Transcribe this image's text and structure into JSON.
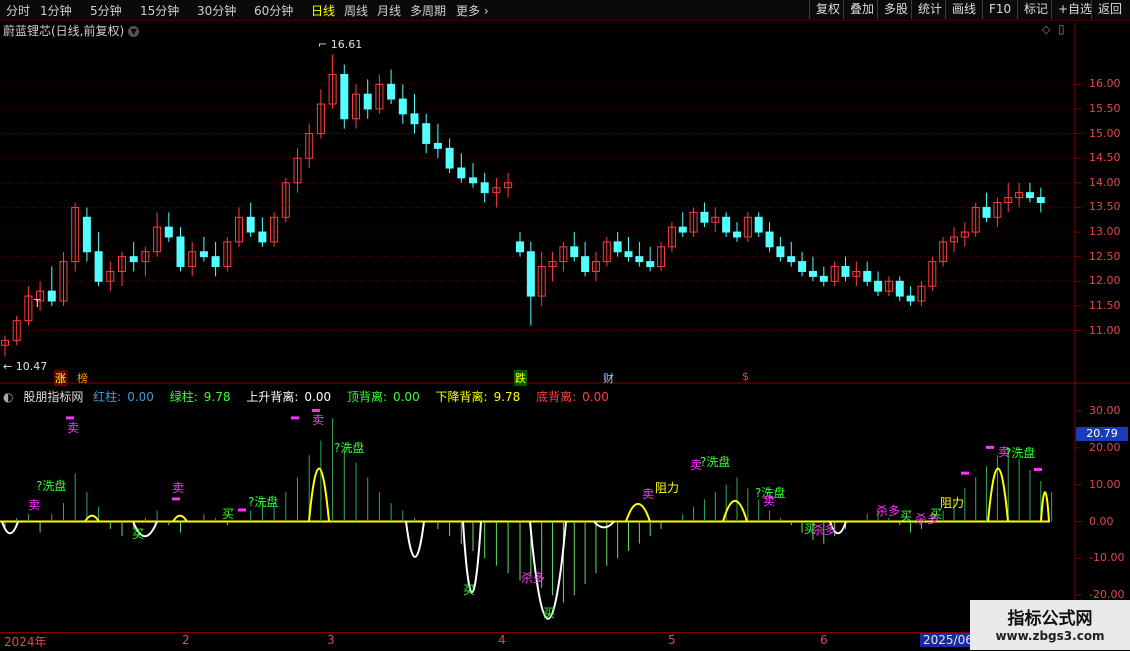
{
  "toolbar": {
    "periods": [
      "分时",
      "1分钟",
      "5分钟",
      "15分钟",
      "30分钟",
      "60分钟",
      "日线",
      "周线",
      "月线",
      "多周期",
      "更多"
    ],
    "active_period": "日线",
    "tools": [
      "复权",
      "叠加",
      "多股",
      "统计",
      "画线",
      "F10",
      "标记",
      "+自选",
      "返回"
    ]
  },
  "stock": {
    "title": "蔚蓝锂芯(日线,前复权)"
  },
  "price_axis": [
    "16.00",
    "15.50",
    "15.00",
    "14.50",
    "14.00",
    "13.50",
    "13.00",
    "12.50",
    "12.00",
    "11.50",
    "11.00"
  ],
  "price_labels": {
    "high": "16.61",
    "low": "10.47"
  },
  "event_marks": [
    "涨",
    "榜",
    "跌",
    "财",
    "$"
  ],
  "indicator": {
    "name": "股朋指标网",
    "red_label": "红柱:",
    "red_value": "0.00",
    "green_label": "绿柱:",
    "green_value": "9.78",
    "up_div_label": "上升背离:",
    "up_div_value": "0.00",
    "top_div_label": "顶背离:",
    "top_div_value": "0.00",
    "down_div_label": "下降背离:",
    "down_div_value": "9.78",
    "bottom_div_label": "底背离:",
    "bottom_div_value": "0.00",
    "current": "20.79"
  },
  "ind_axis": [
    "30.00",
    "20.00",
    "10.00",
    "0.00",
    "-10.00",
    "-20.00"
  ],
  "ind_signals": {
    "buy": "买",
    "sell": "卖",
    "wash": "?洗盘",
    "kill": "杀多",
    "resist": "阻力"
  },
  "dates": [
    "2024年",
    "2",
    "3",
    "4",
    "5",
    "6",
    "2025/06/"
  ],
  "watermark": {
    "title": "指标公式网",
    "url": "www.zbgs3.com"
  },
  "colors": {
    "up": "#ff3c3c",
    "down": "#54ffff",
    "signal_yellow": "#ffff00",
    "signal_magenta": "#ff33ff",
    "buy_green": "#33ff33"
  },
  "chart_data": {
    "type": "candlestick",
    "ohlc": [
      [
        10.7,
        10.9,
        10.47,
        10.8
      ],
      [
        10.8,
        11.3,
        10.7,
        11.2
      ],
      [
        11.2,
        11.9,
        11.1,
        11.7
      ],
      [
        11.6,
        12.0,
        11.4,
        11.8
      ],
      [
        11.8,
        12.3,
        11.5,
        11.6
      ],
      [
        11.6,
        12.6,
        11.5,
        12.4
      ],
      [
        12.4,
        13.6,
        12.2,
        13.5
      ],
      [
        13.3,
        13.5,
        12.4,
        12.6
      ],
      [
        12.6,
        13.0,
        11.9,
        12.0
      ],
      [
        12.0,
        12.4,
        11.8,
        12.2
      ],
      [
        12.2,
        12.6,
        11.9,
        12.5
      ],
      [
        12.5,
        12.8,
        12.2,
        12.4
      ],
      [
        12.4,
        12.7,
        12.1,
        12.6
      ],
      [
        12.6,
        13.4,
        12.5,
        13.1
      ],
      [
        13.1,
        13.4,
        12.8,
        12.9
      ],
      [
        12.9,
        13.1,
        12.2,
        12.3
      ],
      [
        12.3,
        12.8,
        12.1,
        12.6
      ],
      [
        12.6,
        12.9,
        12.4,
        12.5
      ],
      [
        12.5,
        12.8,
        12.1,
        12.3
      ],
      [
        12.3,
        12.9,
        12.2,
        12.8
      ],
      [
        12.8,
        13.5,
        12.7,
        13.3
      ],
      [
        13.3,
        13.6,
        12.9,
        13.0
      ],
      [
        13.0,
        13.3,
        12.7,
        12.8
      ],
      [
        12.8,
        13.4,
        12.7,
        13.3
      ],
      [
        13.3,
        14.1,
        13.2,
        14.0
      ],
      [
        14.0,
        14.7,
        13.8,
        14.5
      ],
      [
        14.5,
        15.2,
        14.3,
        15.0
      ],
      [
        15.0,
        15.9,
        14.9,
        15.6
      ],
      [
        15.6,
        16.61,
        15.5,
        16.2
      ],
      [
        16.2,
        16.4,
        15.1,
        15.3
      ],
      [
        15.3,
        16.0,
        15.1,
        15.8
      ],
      [
        15.8,
        16.1,
        15.3,
        15.5
      ],
      [
        15.5,
        16.2,
        15.4,
        16.0
      ],
      [
        16.0,
        16.3,
        15.6,
        15.7
      ],
      [
        15.7,
        16.0,
        15.2,
        15.4
      ],
      [
        15.4,
        15.8,
        15.0,
        15.2
      ],
      [
        15.2,
        15.4,
        14.6,
        14.8
      ],
      [
        14.8,
        15.2,
        14.5,
        14.7
      ],
      [
        14.7,
        14.9,
        14.2,
        14.3
      ],
      [
        14.3,
        14.6,
        14.0,
        14.1
      ],
      [
        14.1,
        14.4,
        13.9,
        14.0
      ],
      [
        14.0,
        14.2,
        13.6,
        13.8
      ],
      [
        13.8,
        14.1,
        13.5,
        13.9
      ],
      [
        13.9,
        14.2,
        13.7,
        14.0
      ],
      [
        12.8,
        13.0,
        12.5,
        12.6
      ],
      [
        12.6,
        12.8,
        11.1,
        11.7
      ],
      [
        11.7,
        12.6,
        11.5,
        12.3
      ],
      [
        12.3,
        12.6,
        12.0,
        12.4
      ],
      [
        12.4,
        12.8,
        12.2,
        12.7
      ],
      [
        12.7,
        13.0,
        12.4,
        12.5
      ],
      [
        12.5,
        12.8,
        12.1,
        12.2
      ],
      [
        12.2,
        12.6,
        12.0,
        12.4
      ],
      [
        12.4,
        12.9,
        12.3,
        12.8
      ],
      [
        12.8,
        13.0,
        12.5,
        12.6
      ],
      [
        12.6,
        12.9,
        12.4,
        12.5
      ],
      [
        12.5,
        12.8,
        12.3,
        12.4
      ],
      [
        12.4,
        12.7,
        12.2,
        12.3
      ],
      [
        12.3,
        12.8,
        12.2,
        12.7
      ],
      [
        12.7,
        13.2,
        12.6,
        13.1
      ],
      [
        13.1,
        13.4,
        12.9,
        13.0
      ],
      [
        13.0,
        13.5,
        12.9,
        13.4
      ],
      [
        13.4,
        13.6,
        13.1,
        13.2
      ],
      [
        13.2,
        13.5,
        13.0,
        13.3
      ],
      [
        13.3,
        13.4,
        12.9,
        13.0
      ],
      [
        13.0,
        13.2,
        12.8,
        12.9
      ],
      [
        12.9,
        13.4,
        12.8,
        13.3
      ],
      [
        13.3,
        13.4,
        12.9,
        13.0
      ],
      [
        13.0,
        13.2,
        12.6,
        12.7
      ],
      [
        12.7,
        12.9,
        12.4,
        12.5
      ],
      [
        12.5,
        12.8,
        12.3,
        12.4
      ],
      [
        12.4,
        12.6,
        12.1,
        12.2
      ],
      [
        12.2,
        12.5,
        12.0,
        12.1
      ],
      [
        12.1,
        12.3,
        11.9,
        12.0
      ],
      [
        12.0,
        12.4,
        11.9,
        12.3
      ],
      [
        12.3,
        12.5,
        12.0,
        12.1
      ],
      [
        12.1,
        12.4,
        11.9,
        12.2
      ],
      [
        12.2,
        12.4,
        11.9,
        12.0
      ],
      [
        12.0,
        12.2,
        11.7,
        11.8
      ],
      [
        11.8,
        12.1,
        11.7,
        12.0
      ],
      [
        12.0,
        12.1,
        11.6,
        11.7
      ],
      [
        11.7,
        11.9,
        11.5,
        11.6
      ],
      [
        11.6,
        12.0,
        11.5,
        11.9
      ],
      [
        11.9,
        12.5,
        11.8,
        12.4
      ],
      [
        12.4,
        12.9,
        12.3,
        12.8
      ],
      [
        12.8,
        13.1,
        12.6,
        12.9
      ],
      [
        12.9,
        13.2,
        12.7,
        13.0
      ],
      [
        13.0,
        13.6,
        12.9,
        13.5
      ],
      [
        13.5,
        13.8,
        13.2,
        13.3
      ],
      [
        13.3,
        13.7,
        13.1,
        13.6
      ],
      [
        13.6,
        14.0,
        13.4,
        13.7
      ],
      [
        13.7,
        14.0,
        13.5,
        13.8
      ],
      [
        13.8,
        14.0,
        13.6,
        13.7
      ],
      [
        13.7,
        13.9,
        13.4,
        13.6
      ]
    ],
    "indicator_values": [
      -2,
      1,
      2,
      -3,
      2,
      5,
      13,
      8,
      4,
      -2,
      -4,
      -2,
      1,
      3,
      -1,
      -3,
      0,
      2,
      1,
      -1,
      0,
      3,
      5,
      4,
      8,
      12,
      18,
      22,
      28,
      20,
      16,
      12,
      8,
      5,
      3,
      1,
      0,
      -2,
      -4,
      -6,
      -8,
      -10,
      -12,
      -14,
      -16,
      -15,
      -18,
      -20,
      -22,
      -20,
      -17,
      -14,
      -12,
      -10,
      -8,
      -6,
      -4,
      -2,
      0,
      2,
      4,
      6,
      8,
      10,
      12,
      9,
      6,
      3,
      1,
      -1,
      -3,
      -5,
      -6,
      -4,
      -2,
      0,
      2,
      3,
      1,
      -1,
      -3,
      -2,
      0,
      3,
      6,
      9,
      12,
      15,
      18,
      20,
      17,
      14,
      11,
      8
    ],
    "ind_ylim": [
      -30,
      33
    ],
    "ylim": [
      10.3,
      16.9
    ]
  }
}
